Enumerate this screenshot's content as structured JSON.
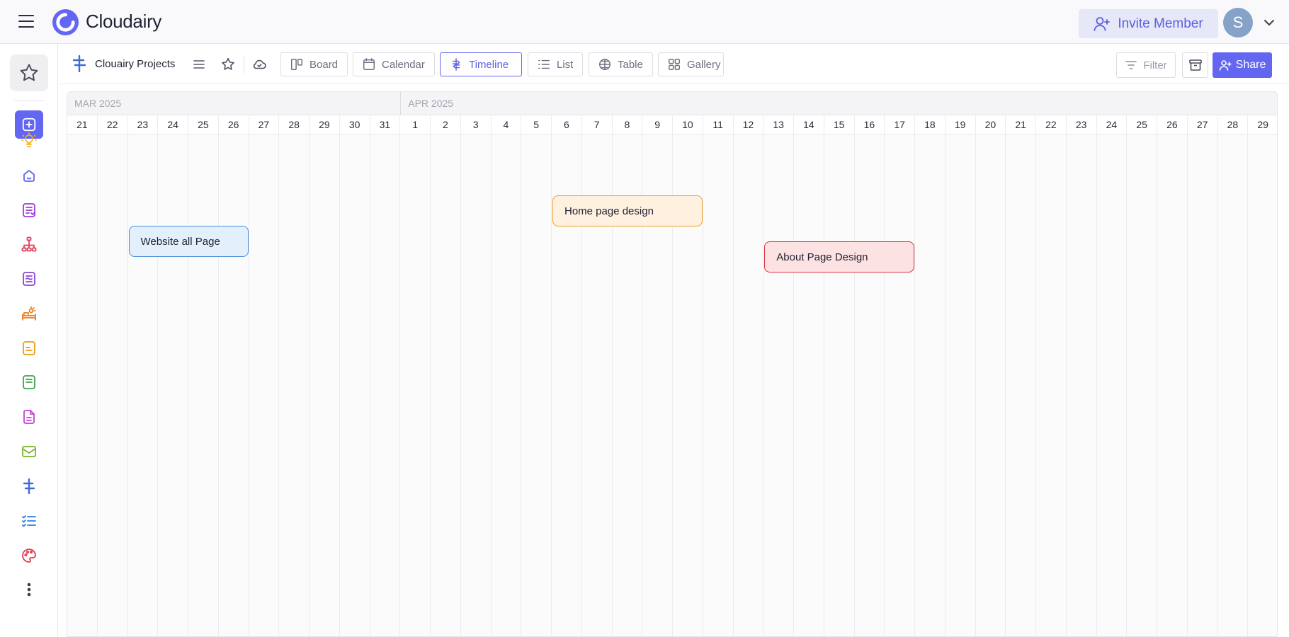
{
  "header": {
    "brand": "Cloudairy",
    "invite_label": "Invite Member",
    "avatar_initial": "S"
  },
  "toolbar": {
    "project_title": "Clouairy Projects",
    "views": [
      {
        "label": "Board",
        "icon": "board-icon"
      },
      {
        "label": "Calendar",
        "icon": "calendar-icon"
      },
      {
        "label": "Timeline",
        "icon": "timeline-icon",
        "active": true
      },
      {
        "label": "List",
        "icon": "list-icon"
      },
      {
        "label": "Table",
        "icon": "table-icon"
      },
      {
        "label": "Gallery",
        "icon": "gallery-icon"
      }
    ],
    "filter_label": "Filter",
    "share_label": "Share"
  },
  "sidebar": {
    "items": [
      {
        "icon": "bulb-icon",
        "color": "#f2b01e"
      },
      {
        "icon": "home-icon",
        "color": "#6366f1"
      },
      {
        "icon": "notes-icon",
        "color": "#9b3fd6"
      },
      {
        "icon": "hierarchy-icon",
        "color": "#e0405a"
      },
      {
        "icon": "document-lines-icon",
        "color": "#8b44d8"
      },
      {
        "icon": "sun-sofa-icon",
        "color": "#ee7a16"
      },
      {
        "icon": "note-yellow-icon",
        "color": "#eb9c12"
      },
      {
        "icon": "note-green-icon",
        "color": "#3fa34d"
      },
      {
        "icon": "file-icon",
        "color": "#c542d6"
      },
      {
        "icon": "mail-icon",
        "color": "#7bb32e"
      },
      {
        "icon": "signpost-icon",
        "color": "#3f6bd8"
      },
      {
        "icon": "checklist-icon",
        "color": "#2f7fe0"
      },
      {
        "icon": "palette-icon",
        "color": "#e03e4f"
      },
      {
        "icon": "more-vertical-icon",
        "color": "#3a3d4a"
      }
    ]
  },
  "timeline": {
    "months": [
      {
        "label": "MAR 2025"
      },
      {
        "label": "APR 2025"
      }
    ],
    "days": [
      "21",
      "22",
      "23",
      "24",
      "25",
      "26",
      "27",
      "28",
      "29",
      "30",
      "31",
      "1",
      "2",
      "3",
      "4",
      "5",
      "6",
      "7",
      "8",
      "9",
      "10",
      "11",
      "12",
      "13",
      "14",
      "15",
      "16",
      "17",
      "18",
      "19",
      "20",
      "21",
      "22",
      "23",
      "24",
      "25",
      "26",
      "27",
      "28",
      "29"
    ],
    "tasks": [
      {
        "label": "Website all Page",
        "start": "2025-03-23",
        "end": "2025-03-26",
        "fill": "#e3f0fc",
        "border": "#4a90d9"
      },
      {
        "label": "Home page design",
        "start": "2025-04-06",
        "end": "2025-04-10",
        "fill": "#fff0e0",
        "border": "#f0a030"
      },
      {
        "label": "About Page Design",
        "start": "2025-04-13",
        "end": "2025-04-17",
        "fill": "#fde2e4",
        "border": "#d9303e"
      }
    ]
  }
}
